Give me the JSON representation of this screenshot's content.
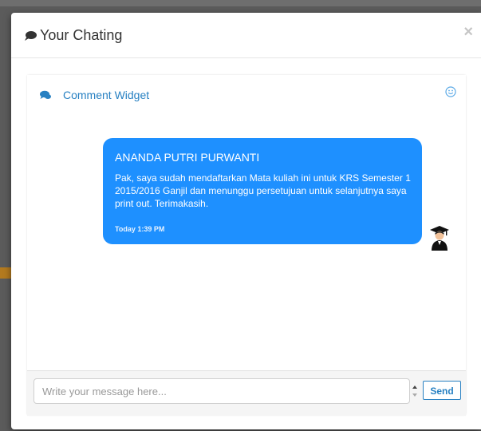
{
  "modal": {
    "title": "Your Chating",
    "close_label": "×"
  },
  "widget": {
    "title": "Comment Widget",
    "icons": {
      "header": "comments-icon",
      "mood": "smile-icon",
      "avatar": "graduate-avatar-icon"
    }
  },
  "messages": [
    {
      "sender": "ANANDA PUTRI PURWANTI",
      "text": "Pak, saya sudah mendaftarkan Mata kuliah ini untuk KRS Semester 1 2015/2016 Ganjil dan menunggu persetujuan untuk selanjutnya saya print out. Terimakasih.",
      "time": "Today 1:39 PM"
    }
  ],
  "composer": {
    "placeholder": "Write your message here...",
    "send_label": "Send"
  },
  "colors": {
    "accent": "#2780c2",
    "bubble": "#1e90ff"
  }
}
